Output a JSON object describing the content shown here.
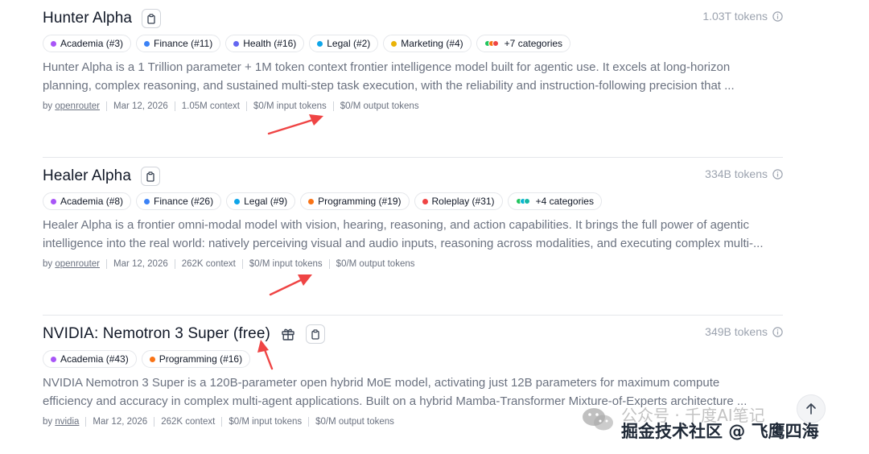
{
  "models": [
    {
      "title": "Hunter Alpha",
      "tokens": "1.03T tokens",
      "has_gift": false,
      "tags": [
        {
          "label": "Academia (#3)",
          "color": "#a855f7"
        },
        {
          "label": "Finance (#11)",
          "color": "#3b82f6"
        },
        {
          "label": "Health (#16)",
          "color": "#6366f1"
        },
        {
          "label": "Legal (#2)",
          "color": "#0ea5e9"
        },
        {
          "label": "Marketing (#4)",
          "color": "#eab308"
        },
        {
          "label": "+7 categories",
          "colors": [
            "#22c55e",
            "#f97316",
            "#ef4444"
          ]
        }
      ],
      "desc": [
        "Hunter Alpha is a 1 Trillion parameter + 1M token context frontier intelligence model built for agentic use. It excels at long-horizon",
        "planning, complex reasoning, and sustained multi-step task execution, with the reliability and instruction-following precision that ..."
      ],
      "author_prefix": "by",
      "author": "openrouter",
      "date": "Mar 12, 2026",
      "context": "1.05M context",
      "input_price": "$0/M input tokens",
      "output_price": "$0/M output tokens"
    },
    {
      "title": "Healer Alpha",
      "tokens": "334B tokens",
      "has_gift": false,
      "tags": [
        {
          "label": "Academia (#8)",
          "color": "#a855f7"
        },
        {
          "label": "Finance (#26)",
          "color": "#3b82f6"
        },
        {
          "label": "Legal (#9)",
          "color": "#0ea5e9"
        },
        {
          "label": "Programming (#19)",
          "color": "#f97316"
        },
        {
          "label": "Roleplay (#31)",
          "color": "#ef4444"
        },
        {
          "label": "+4 categories",
          "colors": [
            "#22c55e",
            "#06b6d4",
            "#14b8a6"
          ]
        }
      ],
      "desc": [
        "Healer Alpha is a frontier omni-modal model with vision, hearing, reasoning, and action capabilities. It brings the full power of agentic",
        "intelligence into the real world: natively perceiving visual and audio inputs, reasoning across modalities, and executing complex multi-..."
      ],
      "author_prefix": "by",
      "author": "openrouter",
      "date": "Mar 12, 2026",
      "context": "262K context",
      "input_price": "$0/M input tokens",
      "output_price": "$0/M output tokens"
    },
    {
      "title": "NVIDIA: Nemotron 3 Super (free)",
      "tokens": "349B tokens",
      "has_gift": true,
      "tags": [
        {
          "label": "Academia (#43)",
          "color": "#a855f7"
        },
        {
          "label": "Programming (#16)",
          "color": "#f97316"
        }
      ],
      "desc": [
        "NVIDIA Nemotron 3 Super is a 120B-parameter open hybrid MoE model, activating just 12B parameters for maximum compute",
        "efficiency and accuracy in complex multi-agent applications. Built on a hybrid Mamba-Transformer Mixture-of-Experts architecture ..."
      ],
      "author_prefix": "by",
      "author": "nvidia",
      "date": "Mar 12, 2026",
      "context": "262K context",
      "input_price": "$0/M input tokens",
      "output_price": "$0/M output tokens"
    }
  ],
  "watermark": {
    "line1": "公众号 · 千度AI笔记",
    "line2": "掘金技术社区 @ 飞鹰四海"
  },
  "colors": {
    "annotation_arrow": "#ef4444"
  }
}
